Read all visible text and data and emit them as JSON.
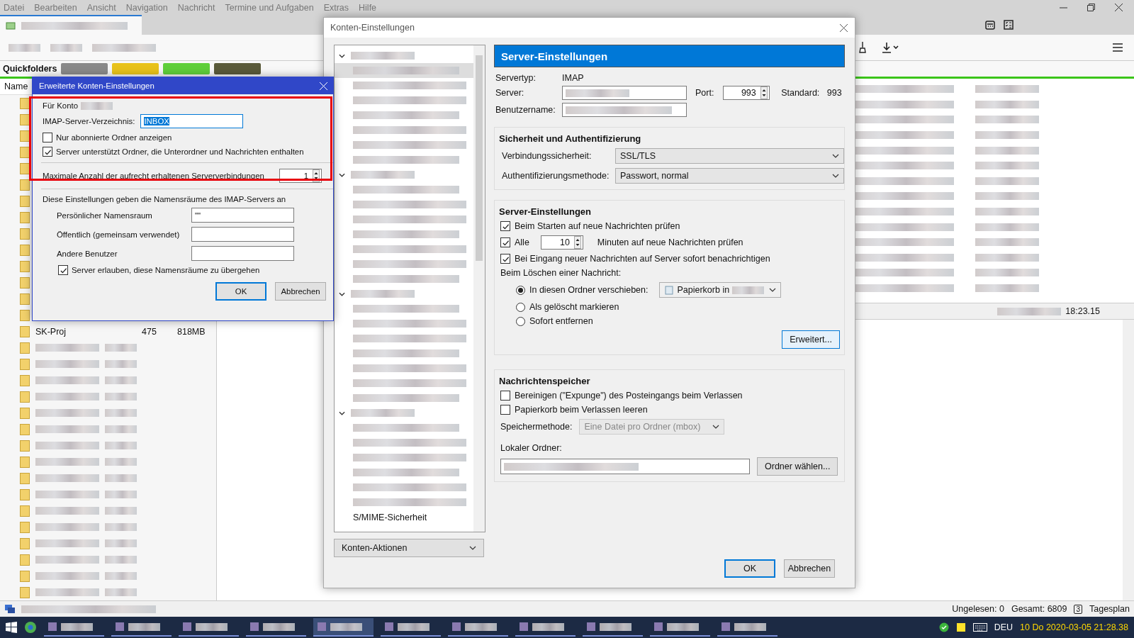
{
  "menu_bar": [
    "Datei",
    "Bearbeiten",
    "Ansicht",
    "Navigation",
    "Nachricht",
    "Termine und Aufgaben",
    "Extras",
    "Hilfe"
  ],
  "main_window": {
    "quickfolders_label": "Quickfolders",
    "folder_column": "Name",
    "folder_row": {
      "name": "SK-Proj",
      "count": "475",
      "size": "818MB"
    },
    "message_time": "18:23.15"
  },
  "account_settings": {
    "title": "Konten-Einstellungen",
    "tree_last_item": "S/MIME-Sicherheit",
    "account_actions": "Konten-Aktionen",
    "header": "Server-Einstellungen",
    "server_type": {
      "label": "Servertyp:",
      "value": "IMAP"
    },
    "server": {
      "label": "Server:"
    },
    "port": {
      "label": "Port:",
      "value": "993",
      "default_label": "Standard:",
      "default_value": "993"
    },
    "username": {
      "label": "Benutzername:"
    },
    "security": {
      "title": "Sicherheit und Authentifizierung",
      "rows": [
        {
          "label": "Verbindungssicherheit:",
          "value": "SSL/TLS"
        },
        {
          "label": "Authentifizierungsmethode:",
          "value": "Passwort, normal"
        }
      ]
    },
    "server_settings": {
      "title": "Server-Einstellungen",
      "check_on_start": {
        "label": "Beim Starten auf neue Nachrichten prüfen",
        "checked": true
      },
      "check_every": {
        "label": "Alle",
        "checked": true,
        "value": "10",
        "suffix": "Minuten auf neue Nachrichten prüfen"
      },
      "notify": {
        "label": "Bei Eingang neuer Nachrichten auf Server sofort benachrichtigen",
        "checked": true
      },
      "delete_label": "Beim Löschen einer Nachricht:",
      "delete_options": [
        {
          "label": "In diesen Ordner verschieben:",
          "selected": true
        },
        {
          "label": "Als gelöscht markieren",
          "selected": false
        },
        {
          "label": "Sofort entfernen",
          "selected": false
        }
      ],
      "target_folder": "Papierkorb in",
      "advanced_button": "Erweitert..."
    },
    "storage": {
      "title": "Nachrichtenspeicher",
      "options": [
        {
          "label": "Bereinigen (\"Expunge\") des Posteingangs beim Verlassen",
          "checked": false
        },
        {
          "label": "Papierkorb beim Verlassen leeren",
          "checked": false
        }
      ],
      "method_label": "Speichermethode:",
      "method_value": "Eine Datei pro Ordner (mbox)",
      "method_disabled": true,
      "local_folder_label": "Lokaler Ordner:",
      "choose_button": "Ordner wählen..."
    },
    "buttons": [
      "OK",
      "Abbrechen"
    ]
  },
  "advanced_dialog": {
    "title": "Erweiterte Konten-Einstellungen",
    "account_label": "Für Konto",
    "imap_dir": {
      "label": "IMAP-Server-Verzeichnis:",
      "value": "INBOX"
    },
    "options": [
      {
        "label": "Nur abonnierte Ordner anzeigen",
        "checked": false
      },
      {
        "label": "Server unterstützt Ordner, die Unterordner und Nachrichten enthalten",
        "checked": true
      }
    ],
    "max_connections": {
      "label": "Maximale Anzahl der aufrecht erhaltenen Serververbindungen",
      "value": "1"
    },
    "namespaces_intro": "Diese Einstellungen geben die Namensräume des IMAP-Servers an",
    "namespaces": [
      {
        "label": "Persönlicher Namensraum",
        "value": "\"\""
      },
      {
        "label": "Öffentlich (gemeinsam verwendet)"
      },
      {
        "label": "Andere Benutzer"
      }
    ],
    "override": {
      "label": "Server erlauben, diese Namensräume zu übergehen",
      "checked": true
    },
    "buttons": [
      "OK",
      "Abbrechen"
    ]
  },
  "status_bar": {
    "unread": "Ungelesen: 0",
    "total": "Gesamt: 6809",
    "agenda_day": "3",
    "agenda": "Tagesplan"
  },
  "taskbar": {
    "language": "DEU",
    "clock": "10 Do 2020-03-05 21:28.38"
  }
}
